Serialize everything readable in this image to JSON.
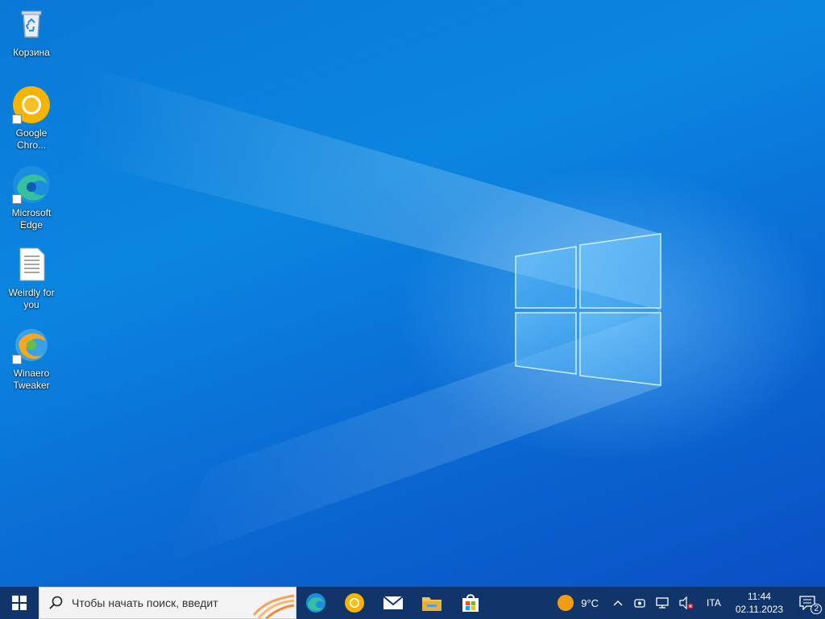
{
  "desktop": {
    "icons": [
      {
        "label": "Корзина",
        "icon": "recycle-bin-icon"
      },
      {
        "label": "Google Chro...",
        "icon": "chrome-canary-icon"
      },
      {
        "label": "Microsoft Edge",
        "icon": "edge-icon"
      },
      {
        "label": "Weirdly for you",
        "icon": "text-document-icon"
      },
      {
        "label": "Winaero Tweaker",
        "icon": "winaero-tweaker-icon"
      }
    ]
  },
  "taskbar": {
    "search_placeholder": "Чтобы начать поиск, введит",
    "pinned": [
      {
        "name": "Microsoft Edge",
        "icon": "edge-icon"
      },
      {
        "name": "Google Chrome",
        "icon": "chrome-canary-icon"
      },
      {
        "name": "Mail",
        "icon": "mail-icon"
      },
      {
        "name": "File Explorer",
        "icon": "folder-icon"
      },
      {
        "name": "Microsoft Store",
        "icon": "store-icon"
      }
    ],
    "weather": {
      "temp": "9°C"
    },
    "language": "ITA",
    "clock": {
      "time": "11:44",
      "date": "02.11.2023"
    },
    "notifications_count": "2"
  },
  "colors": {
    "taskbar_bg": "#11356a",
    "desktop_accent": "#0a78d7"
  }
}
